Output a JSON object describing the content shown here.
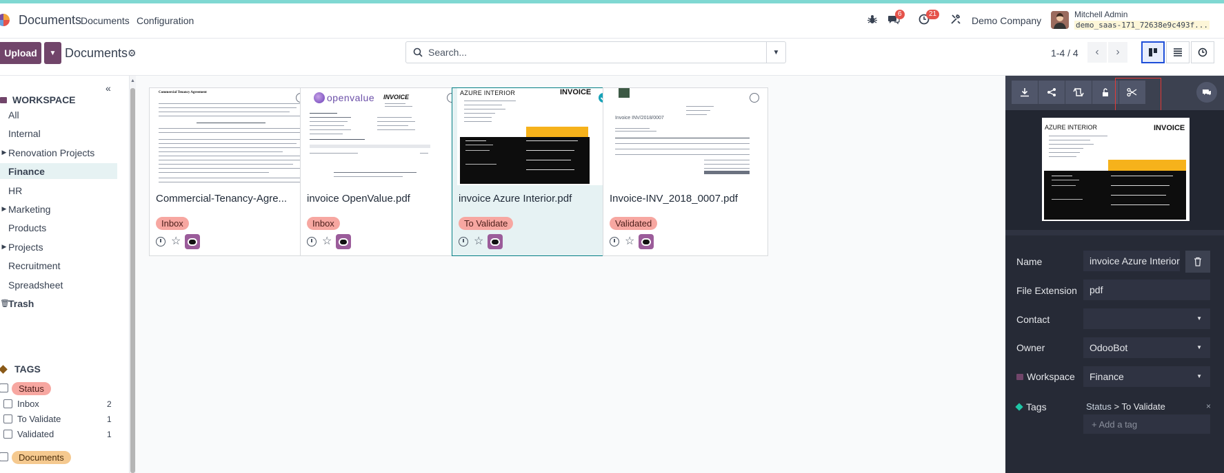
{
  "app": {
    "name": "Documents"
  },
  "nav": {
    "menu": [
      "Documents",
      "Configuration"
    ],
    "chat_badge": "6",
    "activity_badge": "21",
    "company": "Demo Company",
    "user_name": "Mitchell Admin",
    "db_name": "demo_saas-171_72638e9c493f..."
  },
  "control_panel": {
    "upload_label": "Upload",
    "breadcrumb": "Documents",
    "search_placeholder": "Search...",
    "pager": "1-4 / 4"
  },
  "sidebar": {
    "workspace_title": "WORKSPACE",
    "workspaces": [
      {
        "label": "All",
        "expandable": false,
        "active": false
      },
      {
        "label": "Internal",
        "expandable": false,
        "active": false
      },
      {
        "label": "Renovation Projects",
        "expandable": true,
        "active": false
      },
      {
        "label": "Finance",
        "expandable": false,
        "active": true
      },
      {
        "label": "HR",
        "expandable": false,
        "active": false
      },
      {
        "label": "Marketing",
        "expandable": true,
        "active": false
      },
      {
        "label": "Products",
        "expandable": false,
        "active": false
      },
      {
        "label": "Projects",
        "expandable": true,
        "active": false
      },
      {
        "label": "Recruitment",
        "expandable": false,
        "active": false
      },
      {
        "label": "Spreadsheet",
        "expandable": false,
        "active": false
      },
      {
        "label": "Trash",
        "expandable": false,
        "active": false
      }
    ],
    "tags_title": "TAGS",
    "status_group": "Status",
    "status_items": [
      {
        "label": "Inbox",
        "count": "2"
      },
      {
        "label": "To Validate",
        "count": "1"
      },
      {
        "label": "Validated",
        "count": "1"
      }
    ],
    "documents_group": "Documents"
  },
  "cards": [
    {
      "title": "Commercial-Tenancy-Agre...",
      "tag": "Inbox",
      "selected": false
    },
    {
      "title": "invoice OpenValue.pdf",
      "tag": "Inbox",
      "selected": false
    },
    {
      "title": "invoice Azure Interior.pdf",
      "tag": "To Validate",
      "selected": true
    },
    {
      "title": "Invoice-INV_2018_0007.pdf",
      "tag": "Validated",
      "selected": false
    }
  ],
  "thumbs": {
    "tenancy_heading": "Commercial Tenancy Agreement",
    "openvalue_logo": "openvalue",
    "openvalue_invoice": "INVOICE",
    "azure_company": "AZURE INTERIOR",
    "azure_invoice": "INVOICE",
    "inv_heading": "Invoice INV/2018/0007"
  },
  "inspector": {
    "name_label": "Name",
    "name_value": "invoice Azure Interior.pdf",
    "ext_label": "File Extension",
    "ext_value": "pdf",
    "contact_label": "Contact",
    "contact_value": "",
    "owner_label": "Owner",
    "owner_value": "OdooBot",
    "workspace_label": "Workspace",
    "workspace_value": "Finance",
    "tags_label": "Tags",
    "tag_parent": "Status",
    "tag_sep": ">",
    "tag_child": "To Validate",
    "tag_remove": "×",
    "add_tag_placeholder": "+ Add a tag"
  },
  "colors": {
    "brand": "#71456a",
    "accent": "#017e84",
    "tag_inbox": "#f7a7a1",
    "inspector_bg": "#262a36"
  }
}
